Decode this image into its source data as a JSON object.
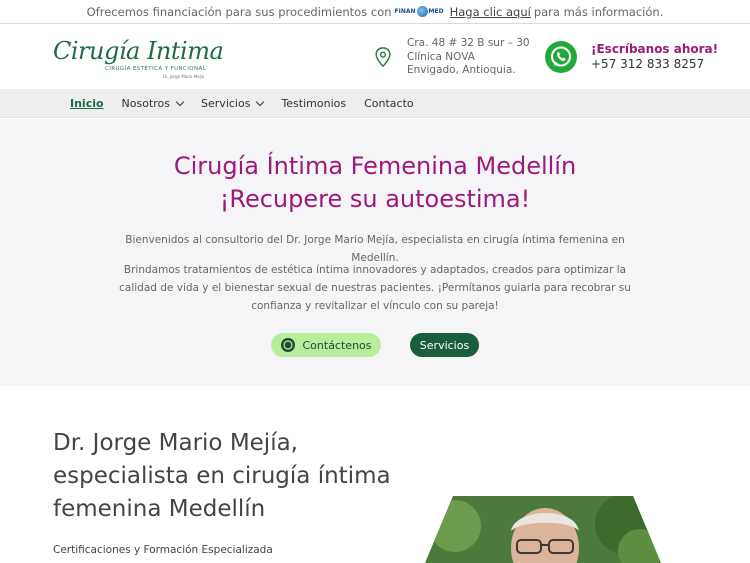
{
  "topbar": {
    "text_before": "Ofrecemos financiación para sus procedimientos con",
    "finan_brand_left": "FINAN",
    "finan_brand_right": "MED",
    "link_label": "Haga clic aquí",
    "text_after": "para más información."
  },
  "header": {
    "logo_script": "Cirugía Intima",
    "logo_subtitle": "CIRUGÍA ESTÉTICA Y FUNCIONAL",
    "logo_doctor": "Dr. Jorge Mario Mejía",
    "address_line1": "Cra. 48 # 32 B sur – 30",
    "address_line2": "Clínica NOVA",
    "address_line3": "Envigado, Antioquia.",
    "whatsapp_title": "¡Escríbanos ahora!",
    "whatsapp_phone": "+57 312 833 8257"
  },
  "nav": {
    "items": [
      {
        "label": "Inicio"
      },
      {
        "label": "Nosotros"
      },
      {
        "label": "Servicios"
      },
      {
        "label": "Testimonios"
      },
      {
        "label": "Contacto"
      }
    ]
  },
  "hero": {
    "title_line1": "Cirugía Íntima Femenina Medellín",
    "title_line2": "¡Recupere su autoestima!",
    "paragraph1": "Bienvenidos al consultorio del Dr. Jorge Mario Mejía, especialista en cirugía íntima femenina en Medellín.",
    "paragraph2": "Brindamos tratamientos de estética íntima innovadores y adaptados, creados para optimizar la calidad de vida y el bienestar sexual de nuestras pacientes. ¡Permítanos guiarla para recobrar su confianza y revitalizar el vínculo con su pareja!",
    "contact_button": "Contáctenos",
    "services_button": "Servicios"
  },
  "about": {
    "heading": "Dr. Jorge Mario Mejía, especialista en cirugía íntima femenina Medellín",
    "subheading": "Certificaciones y Formación Especializada"
  },
  "colors": {
    "brand_green": "#1f6b45",
    "accent_magenta": "#9c1a7c",
    "whatsapp_green": "#25a83a",
    "button_light_green": "#b6ee9c",
    "button_dark_green": "#1b5e3b"
  }
}
